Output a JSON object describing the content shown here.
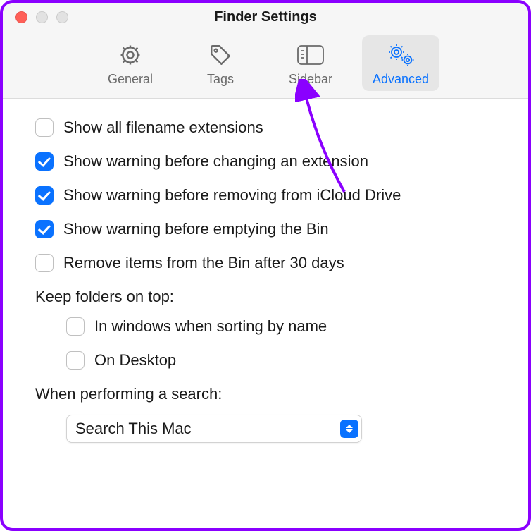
{
  "window": {
    "title": "Finder Settings"
  },
  "tabs": [
    {
      "id": "general",
      "label": "General",
      "active": false
    },
    {
      "id": "tags",
      "label": "Tags",
      "active": false
    },
    {
      "id": "sidebar",
      "label": "Sidebar",
      "active": false
    },
    {
      "id": "advanced",
      "label": "Advanced",
      "active": true
    }
  ],
  "options": {
    "show_ext": {
      "label": "Show all filename extensions",
      "checked": false
    },
    "warn_change_ext": {
      "label": "Show warning before changing an extension",
      "checked": true
    },
    "warn_remove_icloud": {
      "label": "Show warning before removing from iCloud Drive",
      "checked": true
    },
    "warn_empty_bin": {
      "label": "Show warning before emptying the Bin",
      "checked": true
    },
    "remove_30_days": {
      "label": "Remove items from the Bin after 30 days",
      "checked": false
    }
  },
  "keep_folders": {
    "label": "Keep folders on top:",
    "in_windows": {
      "label": "In windows when sorting by name",
      "checked": false
    },
    "on_desktop": {
      "label": "On Desktop",
      "checked": false
    }
  },
  "search": {
    "label": "When performing a search:",
    "value": "Search This Mac"
  }
}
